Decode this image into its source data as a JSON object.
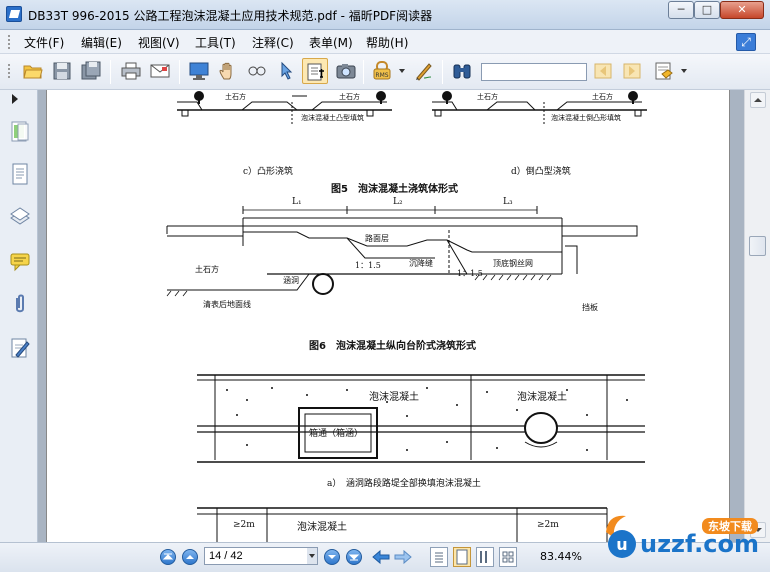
{
  "window": {
    "title": "DB33T 996-2015 公路工程泡沫混凝土应用技术规范.pdf - 福昕PDF阅读器",
    "minimize": "─",
    "maximize": "□",
    "close": "✕"
  },
  "menu": {
    "items": [
      "文件(F)",
      "编辑(E)",
      "视图(V)",
      "工具(T)",
      "注释(C)",
      "表单(M)",
      "帮助(H)"
    ]
  },
  "toolbar": {
    "search_value": "",
    "icons": [
      "open-icon",
      "save-icon",
      "save-as-icon",
      "print-icon",
      "email-icon",
      "fullscreen-icon",
      "hand-tool-icon",
      "snapshot-zoom-icon",
      "select-arrow-icon",
      "text-select-icon",
      "camera-icon",
      "rms-icon",
      "sign-icon",
      "binoculars-icon",
      "search-prev-icon",
      "search-next-icon",
      "highlight-icon"
    ],
    "rms_label": "RMS"
  },
  "document": {
    "fig5_sub_c": "c）凸形浇筑",
    "fig5_sub_d": "d）倒凸型浇筑",
    "fig5_caption": "图5　泡沫混凝土浇筑体形式",
    "fig5_label_left_a": "土石方",
    "fig5_label_left_b": "土石方",
    "fig5_note_left": "泡沫混凝土凸型填筑",
    "fig5_label_right_a": "土石方",
    "fig5_label_right_b": "土石方",
    "fig5_note_right": "泡沫混凝土倒凸形填筑",
    "fig6_l1": "L₁",
    "fig6_l2": "L₂",
    "fig6_l3": "L₃",
    "fig6_road": "路面层",
    "fig6_earth": "土石方",
    "fig6_slope1": "1：1.5",
    "fig6_joint": "沉降缝",
    "fig6_slope2": "1：1.5",
    "fig6_mesh": "顶底钢丝网",
    "fig6_culvert": "涵洞",
    "fig6_ground": "清表后地面线",
    "fig6_board": "挡板",
    "fig6_caption": "图6　泡沫混凝土纵向台阶式浇筑形式",
    "fig7_fill_left": "泡沫混凝土",
    "fig7_fill_right": "泡沫混凝土",
    "fig7_box": "箱通（箱涵）",
    "fig7_sub_a": "a）　涵洞路段路堤全部换填泡沫混凝土",
    "fig7b_left": "≥2m",
    "fig7b_fill": "泡沫混凝土",
    "fig7b_right": "≥2m"
  },
  "status": {
    "page": "14 / 42",
    "zoom": "83.44%"
  },
  "watermark": {
    "brand": "uzzf.com",
    "tag": "东坡下载"
  },
  "colors": {
    "accent": "#2f77cc",
    "viewport_bg": "#a9b4c2",
    "watermark_orange": "#f28b1e",
    "watermark_blue": "#1b74c9"
  }
}
